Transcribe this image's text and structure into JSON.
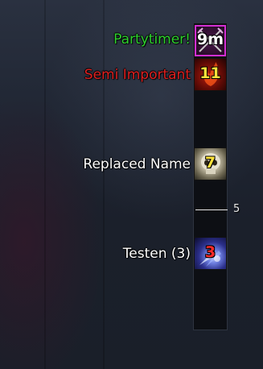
{
  "timeline": {
    "tick_label": "5"
  },
  "timers": [
    {
      "label": "Partytimer!",
      "label_color": "#2fd22f",
      "count": "9m",
      "count_color": "#ffffff",
      "icon": "crossed-swords-icon"
    },
    {
      "label": "Semi Important",
      "label_color": "#e02020",
      "count": "11",
      "count_color": "#ffe23a",
      "icon": "flame-icon"
    },
    {
      "label": "Replaced Name",
      "label_color": "#ffffff",
      "count": "7",
      "count_color": "#ffe23a",
      "icon": "skull-icon"
    },
    {
      "label": "Testen (3)",
      "label_color": "#ffffff",
      "count": "3",
      "count_color": "#ff2a2a",
      "icon": "frost-shard-icon"
    }
  ]
}
